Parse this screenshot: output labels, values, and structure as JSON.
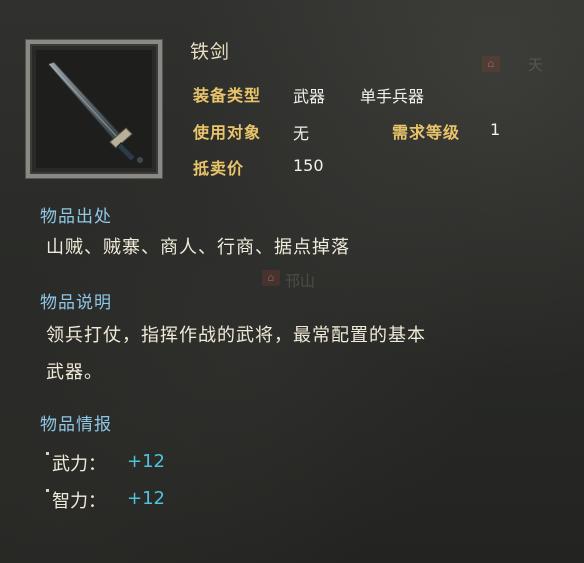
{
  "item": {
    "name": "铁剑",
    "icon": "iron-sword-icon",
    "type_label": "装备类型",
    "type_value": "武器",
    "type_subvalue": "单手兵器",
    "target_label": "使用对象",
    "target_value": "无",
    "level_label": "需求等级",
    "level_value": "1",
    "price_label": "抵卖价",
    "price_value": "150"
  },
  "origin": {
    "heading": "物品出处",
    "text": "山贼、贼寨、商人、行商、据点掉落"
  },
  "description": {
    "heading": "物品说明",
    "line1": "领兵打仗，指挥作战的武将，最常配置的基本",
    "line2": "武器。"
  },
  "info": {
    "heading": "物品情报",
    "stats": [
      {
        "name": "武力：",
        "value": "+12"
      },
      {
        "name": "智力：",
        "value": "+12"
      }
    ]
  },
  "background": {
    "marks": [
      "天",
      "邗山"
    ]
  },
  "colors": {
    "label_gold": "#e9c46a",
    "heading_blue": "#8fc7e6",
    "stat_cyan": "#4fc3dc"
  }
}
